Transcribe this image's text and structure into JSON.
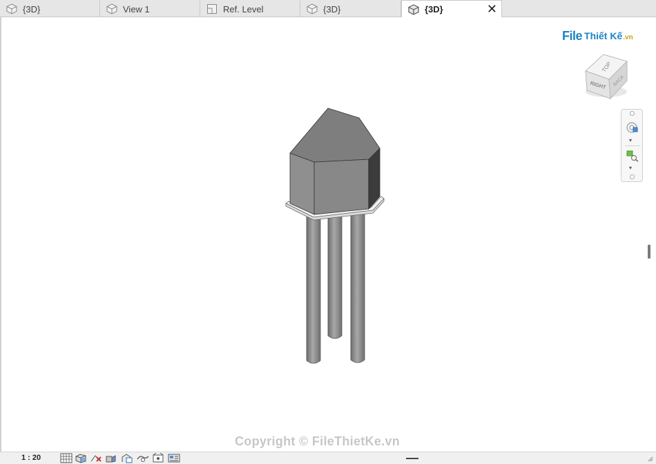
{
  "tabs": [
    {
      "label": "{3D}",
      "active": false
    },
    {
      "label": "View 1",
      "active": false
    },
    {
      "label": "Ref. Level",
      "active": false
    },
    {
      "label": "{3D}",
      "active": false
    },
    {
      "label": "{3D}",
      "active": true
    }
  ],
  "close_label": "✕",
  "logo": {
    "file": "File",
    "rest": "Thiết Kế",
    "vn": ".vn"
  },
  "viewcube": {
    "top_label": "TOP",
    "right_label": "RIGHT",
    "back_label": "BACK"
  },
  "watermark": "Copyright © FileThietKe.vn",
  "status": {
    "scale": "1 : 20"
  },
  "colors": {
    "tabbar": "#e6e6e6",
    "model_front": "#8c8c8c",
    "model_side": "#5a5a5a",
    "model_top": "#7a7a7a",
    "pile": "#8a8a8a",
    "logo_blue": "#1c84c6",
    "logo_gold": "#c7a21a"
  },
  "icons": {
    "tab": "3d-view-icon",
    "ref_level": "plan-view-icon",
    "status": [
      "detail-level-icon",
      "visual-style-icon",
      "sun-path-icon",
      "shadows-icon",
      "crop-view-icon",
      "show-crop-icon",
      "temporary-hide-icon",
      "reveal-hidden-icon",
      "analysis-icon"
    ]
  }
}
